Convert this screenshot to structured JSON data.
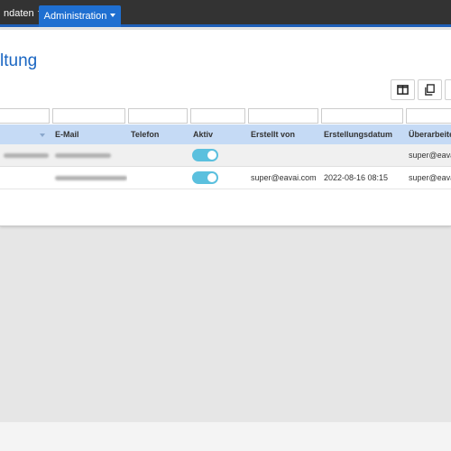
{
  "navbar": {
    "stammdaten_label": "ndaten",
    "administration_label": "Administration"
  },
  "page": {
    "title": "ltung"
  },
  "toolbar": {
    "icons": [
      "columns-icon",
      "copy-icon",
      "file-icon"
    ]
  },
  "table": {
    "columns": [
      "E-Mail",
      "Telefon",
      "Aktiv",
      "Erstellt von",
      "Erstellungsdatum",
      "Überarbeite"
    ],
    "rows": [
      {
        "email": "",
        "telefon": "",
        "aktiv": true,
        "erstellt_von": "",
        "erstellungsdatum": "",
        "ueberarbeitet": "super@eavai"
      },
      {
        "email": "",
        "telefon": "",
        "aktiv": true,
        "erstellt_von": "super@eavai.com",
        "erstellungsdatum": "2022-08-16 08:15",
        "ueberarbeitet": "super@eavai"
      }
    ]
  },
  "colors": {
    "accent": "#1f6fd1",
    "title": "#1a66c2",
    "header_bg": "#c5daf5",
    "toggle_on": "#5bc0de"
  }
}
